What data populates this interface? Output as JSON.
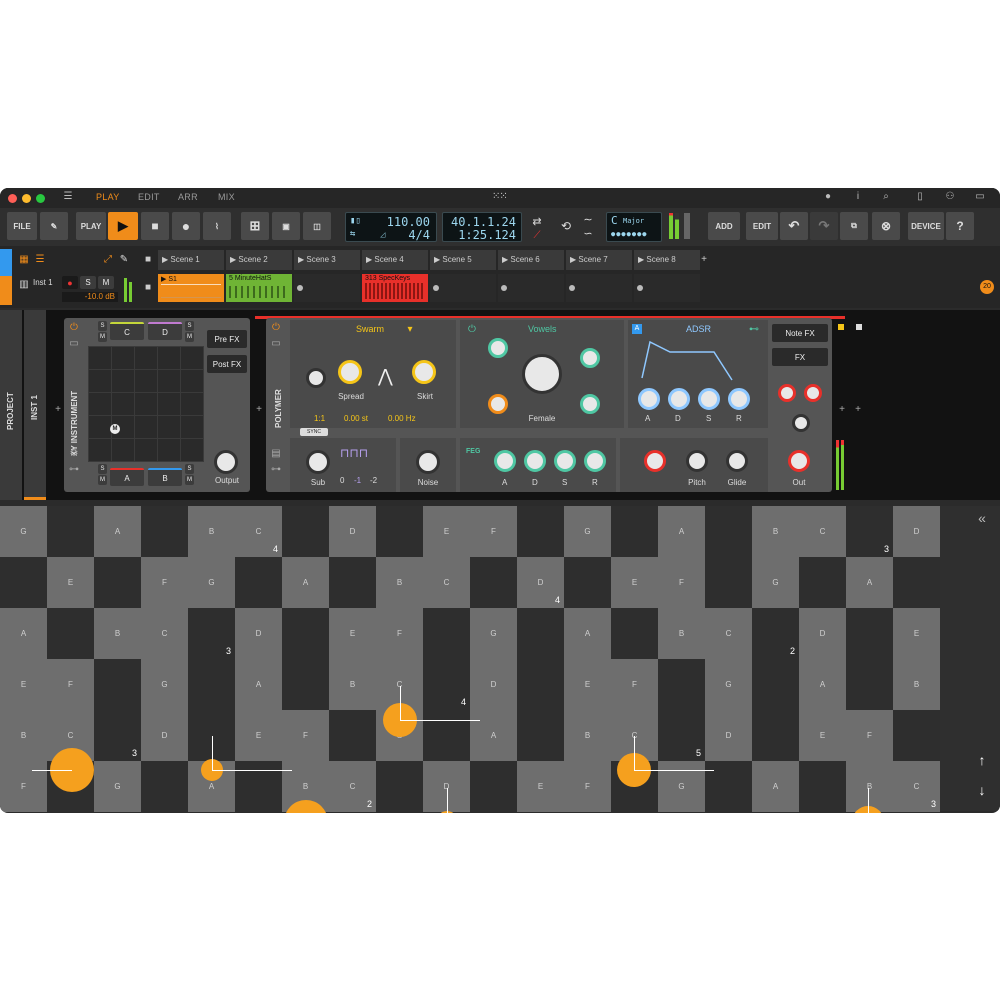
{
  "menu": {
    "modes": [
      "PLAY",
      "EDIT",
      "ARR",
      "MIX"
    ],
    "active_mode": "PLAY"
  },
  "toolbar": {
    "file_label": "FILE",
    "play_label": "PLAY",
    "tempo": "110.00",
    "time_signature": "4/4",
    "position": "40.1.1.24",
    "time": "1:25.124",
    "key_root": "C",
    "key_scale": "Major",
    "add_label": "ADD",
    "edit_label": "EDIT",
    "device_label": "DEVICE",
    "help_label": "?"
  },
  "tracks": {
    "track_name": "Inst 1",
    "track_volume": "-10.0 dB",
    "solo_label": "S",
    "mute_label": "M",
    "scenes": [
      "Scene 1",
      "Scene 2",
      "Scene 3",
      "Scene 4",
      "Scene 5",
      "Scene 6",
      "Scene 7",
      "Scene 8"
    ],
    "clips": [
      {
        "label": "S1",
        "color": "#f08c1a"
      },
      {
        "label": "5 MinuteHatS",
        "color": "#6fb435"
      },
      {
        "label": "313 SpecKeys",
        "color": "#e8302a"
      }
    ],
    "badge": "20"
  },
  "devices": {
    "project_label": "PROJECT",
    "inst_label": "INST 1",
    "xy_instrument": {
      "title": "XY INSTRUMENT",
      "pads_top": [
        "C",
        "D"
      ],
      "pads_bottom": [
        "A",
        "B"
      ],
      "marker": "M",
      "pre_fx": "Pre FX",
      "post_fx": "Post FX",
      "output_label": "Output"
    },
    "polymer": {
      "title": "POLYMER",
      "osc_name": "Swarm",
      "spread_label": "Spread",
      "skirt_label": "Skirt",
      "ratio": "1:1",
      "detune": "0.00 st",
      "freq": "0.00 Hz",
      "sync_label": "SYNC",
      "sub_label": "Sub",
      "octaves": [
        "0",
        "-1",
        "-2"
      ],
      "noise_label": "Noise",
      "filter_name": "Vowels",
      "filter_mode": "Female",
      "envelope_name": "ADSR",
      "adsr": [
        "A",
        "D",
        "S",
        "R"
      ],
      "feg_label": "FEG",
      "feg_adsr": [
        "A",
        "D",
        "S",
        "R"
      ],
      "pitch_label": "Pitch",
      "glide_label": "Glide",
      "note_fx": "Note FX",
      "fx": "FX",
      "out_label": "Out"
    }
  },
  "note_grid": {
    "rows": [
      [
        "G",
        "",
        "A",
        "",
        "B",
        "C",
        "",
        "D",
        "",
        "E",
        "F",
        "",
        "G",
        "",
        "A",
        "",
        "B",
        "C",
        "",
        "D"
      ],
      [
        "",
        "E",
        "",
        "F",
        "G",
        "",
        "A",
        "",
        "B",
        "C",
        "",
        "D",
        "",
        "E",
        "F",
        "",
        "G",
        "",
        "A",
        ""
      ],
      [
        "A",
        "",
        "B",
        "C",
        "",
        "D",
        "",
        "E",
        "F",
        "",
        "G",
        "",
        "A",
        "",
        "B",
        "C",
        "",
        "D",
        "",
        "E"
      ],
      [
        "E",
        "F",
        "",
        "G",
        "",
        "A",
        "",
        "B",
        "C",
        "",
        "D",
        "",
        "E",
        "F",
        "",
        "G",
        "",
        "A",
        "",
        "B"
      ],
      [
        "B",
        "C",
        "",
        "D",
        "",
        "E",
        "F",
        "",
        "G",
        "",
        "A",
        "",
        "B",
        "C",
        "",
        "D",
        "",
        "E",
        "F",
        ""
      ],
      [
        "F",
        "",
        "G",
        "",
        "A",
        "",
        "B",
        "C",
        "",
        "D",
        "",
        "E",
        "F",
        "",
        "G",
        "",
        "A",
        "",
        "B",
        "C"
      ]
    ],
    "octave_numbers": [
      "4",
      "4",
      "3",
      "4",
      "3",
      "2",
      "3",
      "2",
      "5",
      "3"
    ]
  }
}
